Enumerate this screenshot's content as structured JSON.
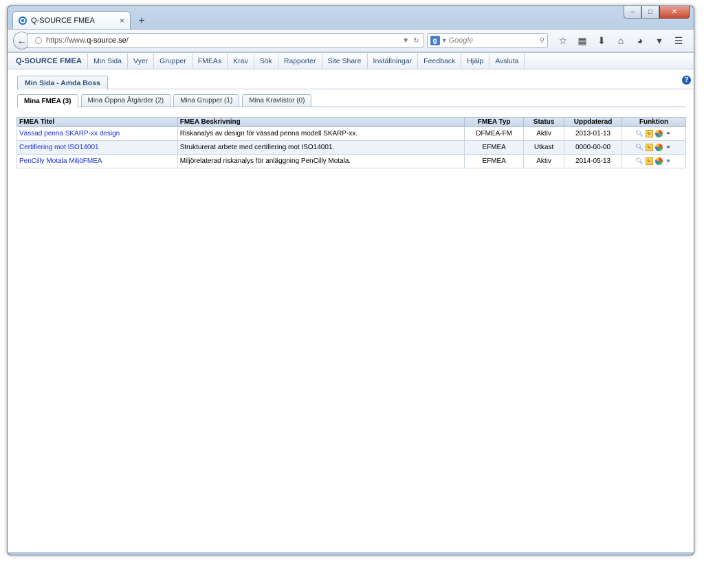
{
  "browser": {
    "tab_title": "Q-SOURCE FMEA",
    "tab_close": "×",
    "new_tab": "+",
    "url_prefix": "https://www.",
    "url_host": "q-source.se",
    "url_suffix": "/",
    "search_placeholder": "Google",
    "search_engine_letter": "g"
  },
  "app": {
    "brand": "Q-SOURCE FMEA",
    "menu": [
      "Min Sida",
      "Vyer",
      "Grupper",
      "FMEAs",
      "Krav",
      "Sök",
      "Rapporter",
      "Site Share",
      "Inställningar",
      "Feedback",
      "Hjälp",
      "Avsluta"
    ]
  },
  "page": {
    "tab_label": "Min Sida - Amda Boss",
    "help": "?"
  },
  "subtabs": [
    {
      "label": "Mina FMEA (3)",
      "active": true
    },
    {
      "label": "Mina Öppna Åtgärder (2)",
      "active": false
    },
    {
      "label": "Mina Grupper (1)",
      "active": false
    },
    {
      "label": "Mina Kravlistor (0)",
      "active": false
    }
  ],
  "table": {
    "headers": {
      "title": "FMEA Titel",
      "description": "FMEA Beskrivning",
      "type": "FMEA Typ",
      "status": "Status",
      "updated": "Uppdaterad",
      "function": "Funktion"
    },
    "rows": [
      {
        "title": "Vässad penna SKARP-xx design",
        "description": "Riskanalys av design för vässad penna modell SKARP-xx.",
        "type": "DFMEA-FM",
        "status": "Aktiv",
        "updated": "2013-01-13"
      },
      {
        "title": "Certifiering mot ISO14001",
        "description": "Strukturerat arbete med certifiering mot ISO14001.",
        "type": "EFMEA",
        "status": "Utkast",
        "updated": "0000-00-00"
      },
      {
        "title": "PenCilly Motala MiljöFMEA",
        "description": "Miljörelaterad riskanalys för anläggning PenCilly Motala.",
        "type": "EFMEA",
        "status": "Aktiv",
        "updated": "2014-05-13"
      }
    ]
  },
  "colors": {
    "link": "#1a2fd0",
    "brand": "#27476e",
    "header_bg": "#c8d6e7"
  }
}
